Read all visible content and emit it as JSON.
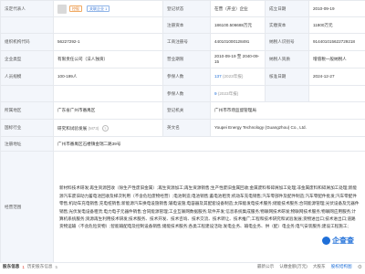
{
  "rows": {
    "legal_rep_label": "法定代表人",
    "legal_rep_badge1": "控股",
    "legal_rep_badge2": "关联企业 1",
    "status_label": "登记状态",
    "status_value": "在营（开业）企业",
    "found_label": "成立日期",
    "found_value": "2010-09-19",
    "reg_capital_label": "注册资本",
    "reg_capital_value": "186100.506688万元",
    "paid_capital_label": "实缴资本",
    "paid_capital_value": "11800万元",
    "org_code_label": "组织机构代码",
    "org_code_value": "56227292-1",
    "reg_no_label": "工商注册号",
    "reg_no_value": "440101000128491",
    "taxpayer_id_label": "纳税人识别号",
    "taxpayer_id_value": "914401015622729218",
    "type_label": "企业类型",
    "type_value": "有限责任公司（法人独资）",
    "term_label": "营业期限",
    "term_value": "2010-09-19 至 2040-09-15",
    "taxpayer_q_label": "纳税人资质",
    "taxpayer_q_value": "增值税一般纳税人",
    "staff_label": "人员规模",
    "staff_value": "100-199人",
    "insured_label": "参保人数",
    "insured_value": "137",
    "insured_note": "(2023年报)",
    "approval_label": "核准日期",
    "approval_value": "2024-12-27",
    "insured_sub_label": "参保人数",
    "insured_sub_value": "9",
    "insured_sub_note": "(2023年报)",
    "region_label": "所属地区",
    "region_value": "广东省广州市番禺区",
    "authority_label": "登记机关",
    "authority_value": "广州市市场监督管理局",
    "industry_label": "国标行业",
    "industry_value": "研究和试验发展",
    "industry_code": "(M73)",
    "en_name_label": "英文名",
    "en_name_value": "Youpei Energy Technology (Guangzhou) Co., Ltd.",
    "address_label": "注册地址",
    "address_value": "广州市番禺区石楼镇金瑞二路39号",
    "scope_label": "经营范围",
    "scope_value": "新材料技术研发;再生资源回收（除生产性废旧金属）;再生资源加工;再生资源销售;生产性废旧金属回收;金属废料和碎屑加工处理;非金属废料和碎屑加工处理;新能源汽车废旧动力蓄电池回收及梯次利用（不含危险废物经营）;电池制造;电池销售;蓄电池租赁;机动车充电销售;汽车零部件及配件制造;汽车零配件批发;汽车零配件零售;机动车充电销售;充电桩销售;新能源汽车换电设施销售;输电设施;电容器及其配套设备制造;太阳能发电技术服务;储能技术服务;合同能源管理;光伏设备及元器件销售;光伏发电设备租赁;电力电子元器件销售;合同能源管理;工业互联网数据服务;软件开发;信息系统集成服务;物联网技术研发;物联网技术服务;物联网应用服务;计算机系统服务;资源再生利用技术研发;技术服务、技术开发、技术咨询、技术交流、技术转让、技术推广;工程和技术研究和试验发展;货物进出口;技术进出口;道路货物运输（不含危险货物）;智能输配电及控制设备销售;储能技术服务;各类工程建设活动;发电业务、输电业务、供（配）电业务;电气安装服务;建设工程施工;"
  },
  "footer": {
    "report_label": "股东信息",
    "report_count": "1",
    "history_label": "历史股东信息",
    "history_count": "5",
    "brand": "企查查",
    "link1": "最新公示",
    "link2": "认缴金额(万元)",
    "link3": "大股东",
    "link4": "股权结构图"
  }
}
